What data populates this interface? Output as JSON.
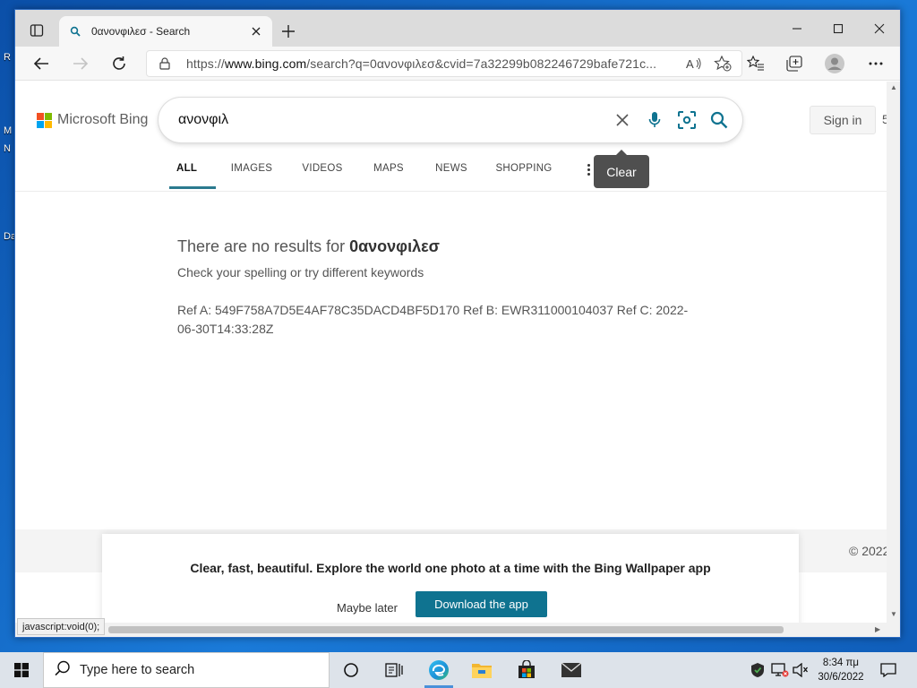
{
  "desktop": {
    "icon_labels": [
      "R",
      "M",
      "N",
      "Da"
    ]
  },
  "browser": {
    "tab": {
      "title": "0ανονφιλεσ - Search"
    },
    "address_bar": {
      "url_prefix": "https://",
      "url_host": "www.bing.com",
      "url_rest": "/search?q=0ανονφιλεσ&cvid=7a32299b082246729bafe721c..."
    }
  },
  "bing": {
    "brand": "Microsoft Bing",
    "query": "ανονφιλ",
    "sign_in": "Sign in",
    "edge_cut_text": "5",
    "tooltip": "Clear",
    "scopes": [
      "ALL",
      "IMAGES",
      "VIDEOS",
      "MAPS",
      "NEWS",
      "SHOPPING"
    ],
    "active_scope": "ALL",
    "no_results_prefix": "There are no results for ",
    "no_results_term": "0ανονφιλεσ",
    "hint": "Check your spelling or try different keywords",
    "ref_text": "Ref A: 549F758A7D5E4AF78C35DACD4BF5D170 Ref B: EWR311000104037 Ref C: 2022-06-30T14:33:28Z",
    "copyright": "© 2022",
    "promo": {
      "text": "Clear, fast, beautiful. Explore the world one photo at a time with the Bing Wallpaper app",
      "maybe_later": "Maybe later",
      "download": "Download the app"
    },
    "status_text": "javascript:void(0);"
  },
  "colors": {
    "accent": "#2b7a8f",
    "download_button": "#0f7390",
    "mic_icon": "#0f7390",
    "ms_red": "#f25022",
    "ms_green": "#7fba00",
    "ms_blue": "#00a4ef",
    "ms_yellow": "#ffb900"
  },
  "taskbar": {
    "search_placeholder": "Type here to search",
    "time": "8:34 πμ",
    "date": "30/6/2022",
    "pinned": [
      "task-view-icon",
      "widgets-icon",
      "edge-icon",
      "file-explorer-icon",
      "store-icon",
      "mail-icon"
    ]
  }
}
